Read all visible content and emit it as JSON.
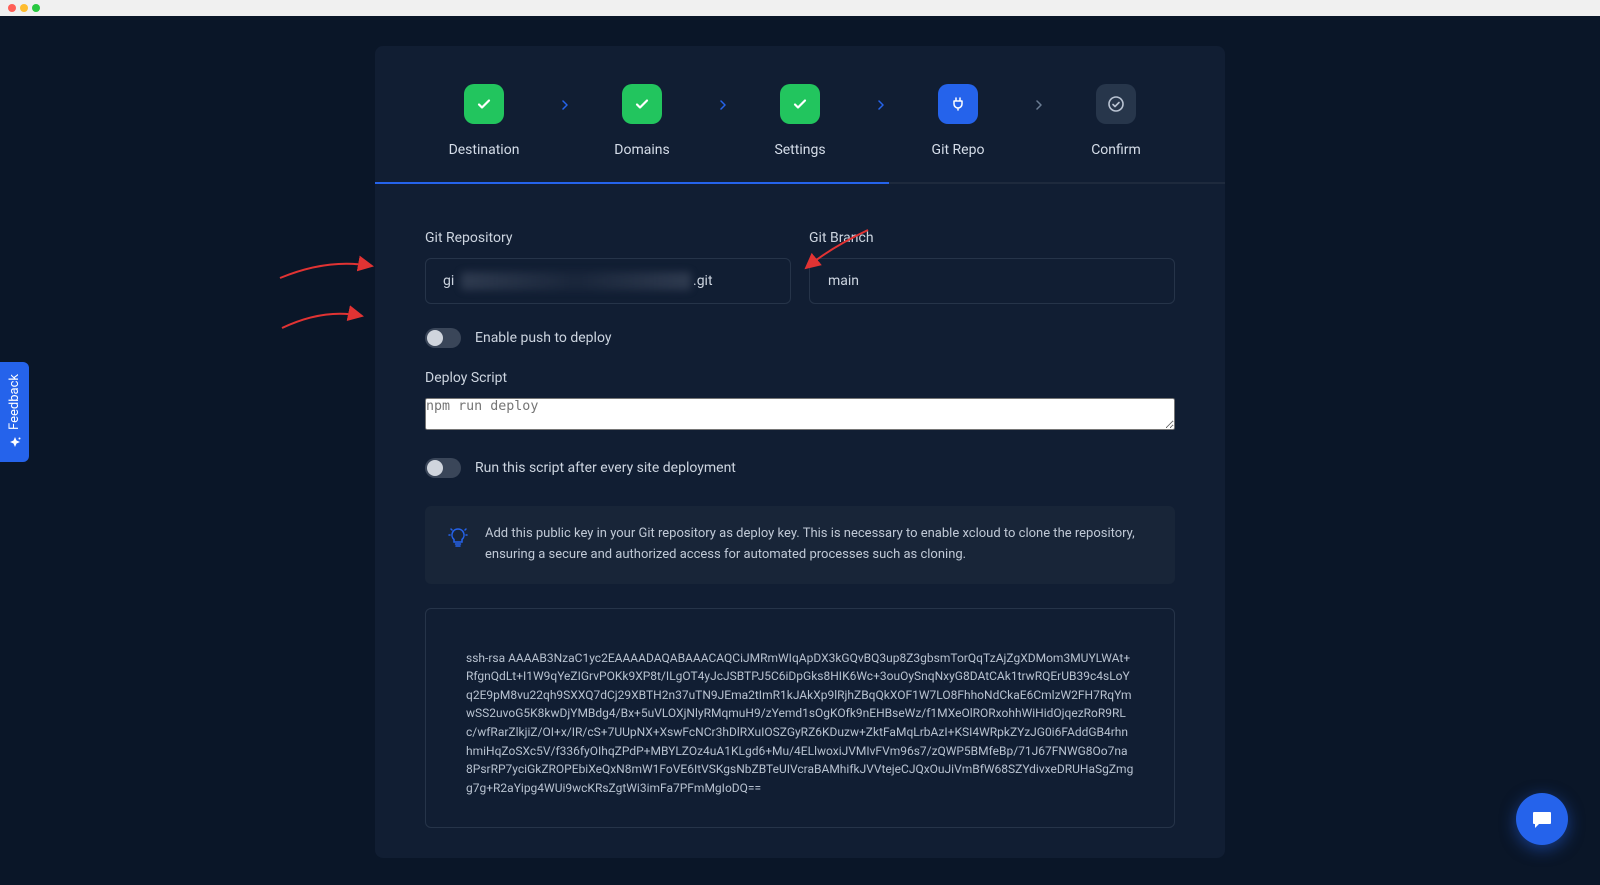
{
  "stepper": {
    "steps": [
      {
        "label": "Destination",
        "state": "done"
      },
      {
        "label": "Domains",
        "state": "done"
      },
      {
        "label": "Settings",
        "state": "done"
      },
      {
        "label": "Git Repo",
        "state": "active"
      },
      {
        "label": "Confirm",
        "state": "pending"
      }
    ]
  },
  "form": {
    "git_repo_label": "Git Repository",
    "git_repo_prefix": "gi",
    "git_repo_suffix": ".git",
    "git_branch_label": "Git Branch",
    "git_branch_value": "main",
    "push_deploy_label": "Enable push to deploy",
    "deploy_script_label": "Deploy Script",
    "deploy_script_placeholder": "npm run deploy",
    "run_script_label": "Run this script after every site deployment",
    "info_text": "Add this public key in your Git repository as deploy key. This is necessary to enable xcloud to clone the repository, ensuring a secure and authorized access for automated processes such as cloning.",
    "ssh_key": "ssh-rsa AAAAB3NzaC1yc2EAAAADAQABAAACAQCiJMRmWIqApDX3kGQvBQ3up8Z3gbsmTorQqTzAjZgXDMom3MUYLWAt+RfgnQdLt+I1W9qYeZIGrvPOKk9XP8t/ILgOT4yJcJSBTPJ5C6iDpGks8HIK6Wc+3ouOySnqNxyG8DAtCAk1trwRQErUB39c4sLoYq2E9pM8vu22qh9SXXQ7dCj29XBTH2n37uTN9JEma2tImR1kJAkXp9lRjhZBqQkXOF1W7LO8FhhoNdCkaE6CmlzW2FH7RqYmwSS2uvoG5K8kwDjYMBdg4/Bx+5uVLOXjNlyRMqmuH9/zYemd1sOgKOfk9nEHBseWz/f1MXeOlRORxohhWiHidOjqezRoR9RLc/wfRarZlkjiZ/OI+x/IR/cS+7UUpNX+XswFcNCr3hDlRXuIOSZGyRZ6KDuzw+ZktFaMqLrbAzI+KSI4WRpkZYzJG0i6FAddGB4rhnhmiHqZoSXc5V/f336fyOIhqZPdP+MBYLZOz4uA1KLgd6+Mu/4ELlwoxiJVMIvFVm96s7/zQWP5BMfeBp/71J67FNWG8Oo7na8PsrRP7yciGkZROPEbiXeQxN8mW1FoVE6ItVSKgsNbZBTeUIVcraBAMhifkJVVtejeCJQxOuJiVmBfW68SZYdivxeDRUHaSgZmgg7g+R2aYipg4WUi9wcKRsZgtWi3imFa7PFmMgIoDQ=="
  },
  "feedback_label": "Feedback"
}
